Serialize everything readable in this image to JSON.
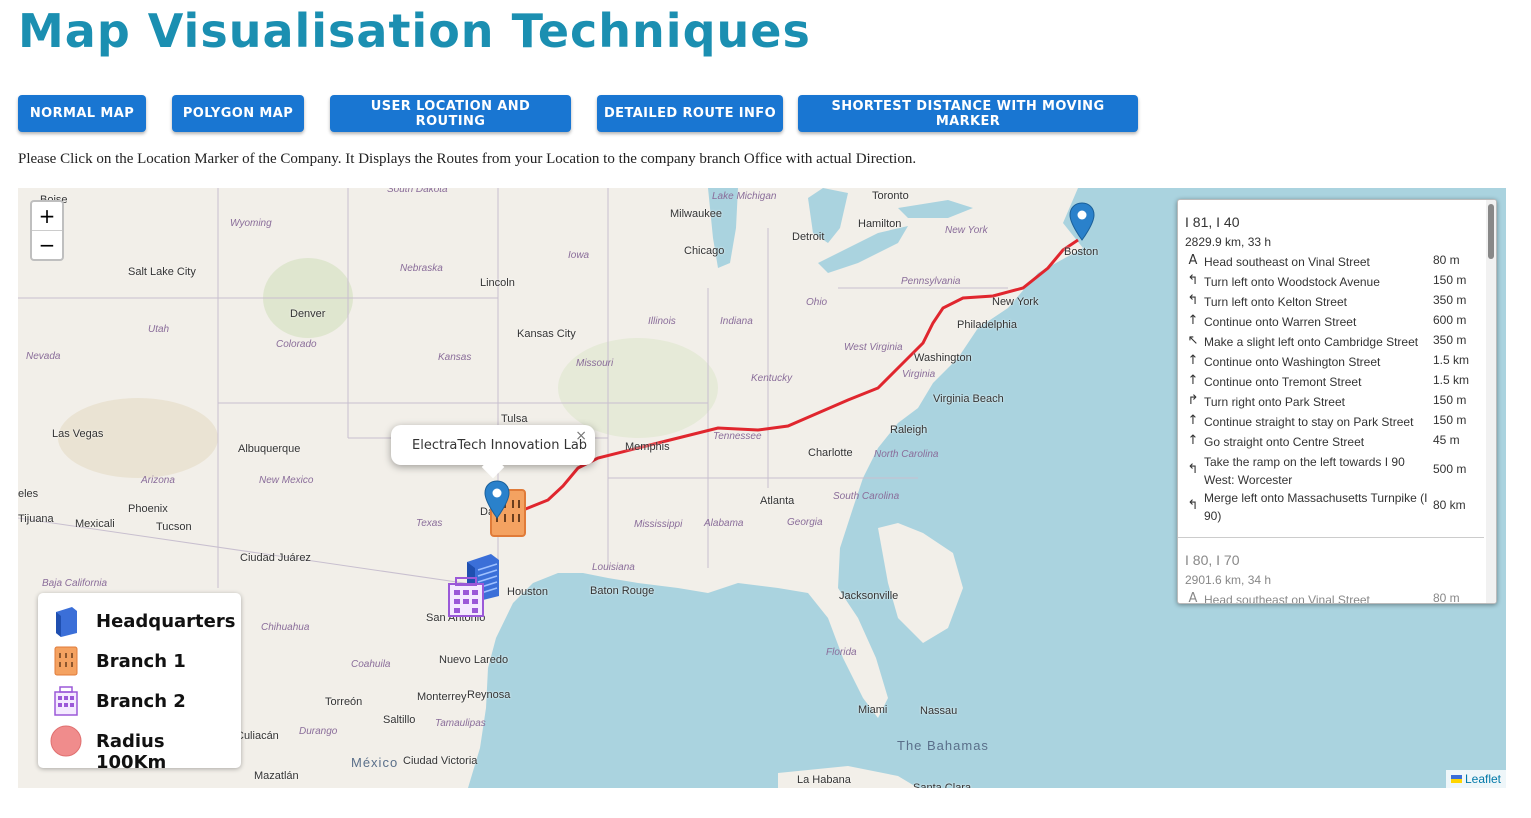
{
  "page": {
    "title": "Map Visualisation Techniques",
    "instructions": "Please Click on the Location Marker of the Company. It Displays the Routes from your Location to the company branch Office with actual Direction."
  },
  "nav": {
    "buttons": [
      "NORMAL MAP",
      "POLYGON MAP",
      "USER LOCATION AND ROUTING",
      "DETAILED ROUTE INFO",
      "SHORTEST DISTANCE WITH MOVING MARKER"
    ]
  },
  "map": {
    "zoom_in": "+",
    "zoom_out": "−",
    "attribution": "Leaflet",
    "popup": {
      "text": "ElectraTech Innovation Lab",
      "close": "×"
    },
    "cities": [
      "Boise",
      "Wyoming",
      "Salt Lake City",
      "Nebraska",
      "Denver",
      "Colorado",
      "Utah",
      "Nevada",
      "Las Vegas",
      "Kansas",
      "Lincoln",
      "Iowa",
      "Kansas City",
      "Missouri",
      "Illinois",
      "Indiana",
      "Ohio",
      "Chicago",
      "Milwaukee",
      "Lake Michigan",
      "Detroit",
      "Toronto",
      "Hamilton",
      "New York",
      "Boston",
      "Pennsylvania",
      "New York",
      "Philadelphia",
      "West Virginia",
      "Washington",
      "Virginia",
      "Kentucky",
      "Virginia Beach",
      "Tulsa",
      "Memphis",
      "Tennessee",
      "Raleigh",
      "North Carolina",
      "Charlotte",
      "Atlanta",
      "South Carolina",
      "Georgia",
      "Alabama",
      "Mississippi",
      "Albuquerque",
      "New Mexico",
      "Arizona",
      "Phoenix",
      "Tucson",
      "Tijuana",
      "Mexicali",
      "Ciudad Juárez",
      "Texas",
      "Houston",
      "San Antonio",
      "Baton Rouge",
      "Louisiana",
      "Jacksonville",
      "Florida",
      "Miami",
      "Nassau",
      "The Bahamas",
      "Chihuahua",
      "Coahuila",
      "Nuevo Laredo",
      "Monterrey",
      "Reynosa",
      "Saltillo",
      "Torreón",
      "Tamaulipas",
      "Durango",
      "México",
      "Ciudad Victoria",
      "Mazatlán",
      "La Habana",
      "Baja California",
      "Culiacán",
      "eles",
      "Dallas",
      "Santa Clara",
      "South Dakota"
    ]
  },
  "route_panel": {
    "alternatives": [
      {
        "title": "I 81, I 40",
        "summary": "2829.9 km, 33 h",
        "steps": [
          {
            "icon": "depart-icon",
            "text": "Head southeast on Vinal Street",
            "distance": "80 m"
          },
          {
            "icon": "turn-left-icon",
            "text": "Turn left onto Woodstock Avenue",
            "distance": "150 m"
          },
          {
            "icon": "turn-left-icon",
            "text": "Turn left onto Kelton Street",
            "distance": "350 m"
          },
          {
            "icon": "continue-icon",
            "text": "Continue onto Warren Street",
            "distance": "600 m"
          },
          {
            "icon": "slight-left-icon",
            "text": "Make a slight left onto Cambridge Street",
            "distance": "350 m"
          },
          {
            "icon": "continue-icon",
            "text": "Continue onto Washington Street",
            "distance": "1.5 km"
          },
          {
            "icon": "continue-icon",
            "text": "Continue onto Tremont Street",
            "distance": "1.5 km"
          },
          {
            "icon": "turn-right-icon",
            "text": "Turn right onto Park Street",
            "distance": "150 m"
          },
          {
            "icon": "continue-icon",
            "text": "Continue straight to stay on Park Street",
            "distance": "150 m"
          },
          {
            "icon": "continue-icon",
            "text": "Go straight onto Centre Street",
            "distance": "45 m"
          },
          {
            "icon": "ramp-left-icon",
            "text": "Take the ramp on the left towards I 90 West: Worcester",
            "distance": "500 m"
          },
          {
            "icon": "merge-left-icon",
            "text": "Merge left onto Massachusetts Turnpike (I 90)",
            "distance": "80 km"
          }
        ]
      },
      {
        "title": "I 80, I 70",
        "summary": "2901.6 km, 34 h",
        "steps": [
          {
            "icon": "depart-icon",
            "text": "Head southeast on Vinal Street",
            "distance": "80 m"
          }
        ]
      }
    ]
  },
  "legend": {
    "items": [
      {
        "label": "Headquarters",
        "icon": "headquarters-icon"
      },
      {
        "label": "Branch 1",
        "icon": "branch1-icon"
      },
      {
        "label": "Branch 2",
        "icon": "branch2-icon"
      },
      {
        "label": "Radius 100Km",
        "icon": "radius-icon"
      }
    ]
  },
  "colors": {
    "title": "#1b8fb1",
    "button": "#1976d2",
    "water": "#aad3df",
    "land": "#f2efe9",
    "route": "#e0262e",
    "marker": "#2a81cb",
    "radius": "#f08c8c"
  }
}
